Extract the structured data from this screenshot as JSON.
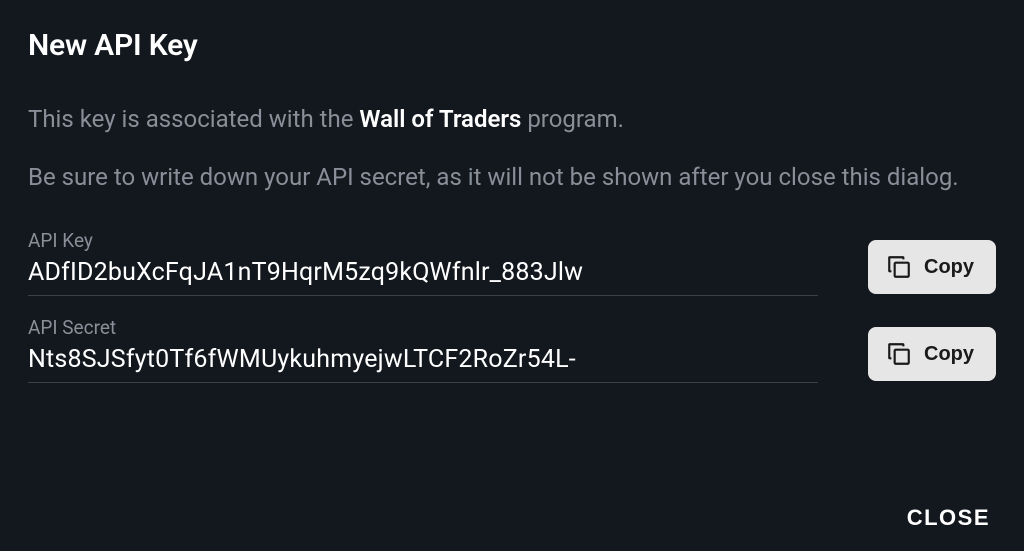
{
  "dialog": {
    "title": "New API Key",
    "description_prefix": "This key is associated with the ",
    "description_program": "Wall of Traders",
    "description_suffix": " program.",
    "warning": "Be sure to write down your API secret, as it will not be shown after you close this dialog."
  },
  "fields": {
    "api_key": {
      "label": "API Key",
      "value": "ADfID2buXcFqJA1nT9HqrM5zq9kQWfnlr_883Jlw"
    },
    "api_secret": {
      "label": "API Secret",
      "value": "Nts8SJSfyt0Tf6fWMUykuhmyejwLTCF2RoZr54L-"
    }
  },
  "buttons": {
    "copy": "Copy",
    "close": "CLOSE"
  }
}
